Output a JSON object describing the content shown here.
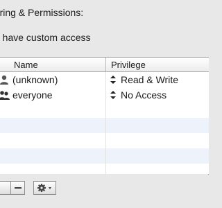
{
  "section_header": "haring & Permissions:",
  "access_note": "u have custom access",
  "table": {
    "columns": [
      "Name",
      "Privilege"
    ],
    "rows": [
      {
        "name": "(unknown)",
        "privilege": "Read & Write",
        "icon": "user-icon"
      },
      {
        "name": "everyone",
        "privilege": "No Access",
        "icon": "group-icon"
      }
    ]
  },
  "toolbar": {
    "remove_label": "−",
    "action_icon": "gear-icon"
  }
}
